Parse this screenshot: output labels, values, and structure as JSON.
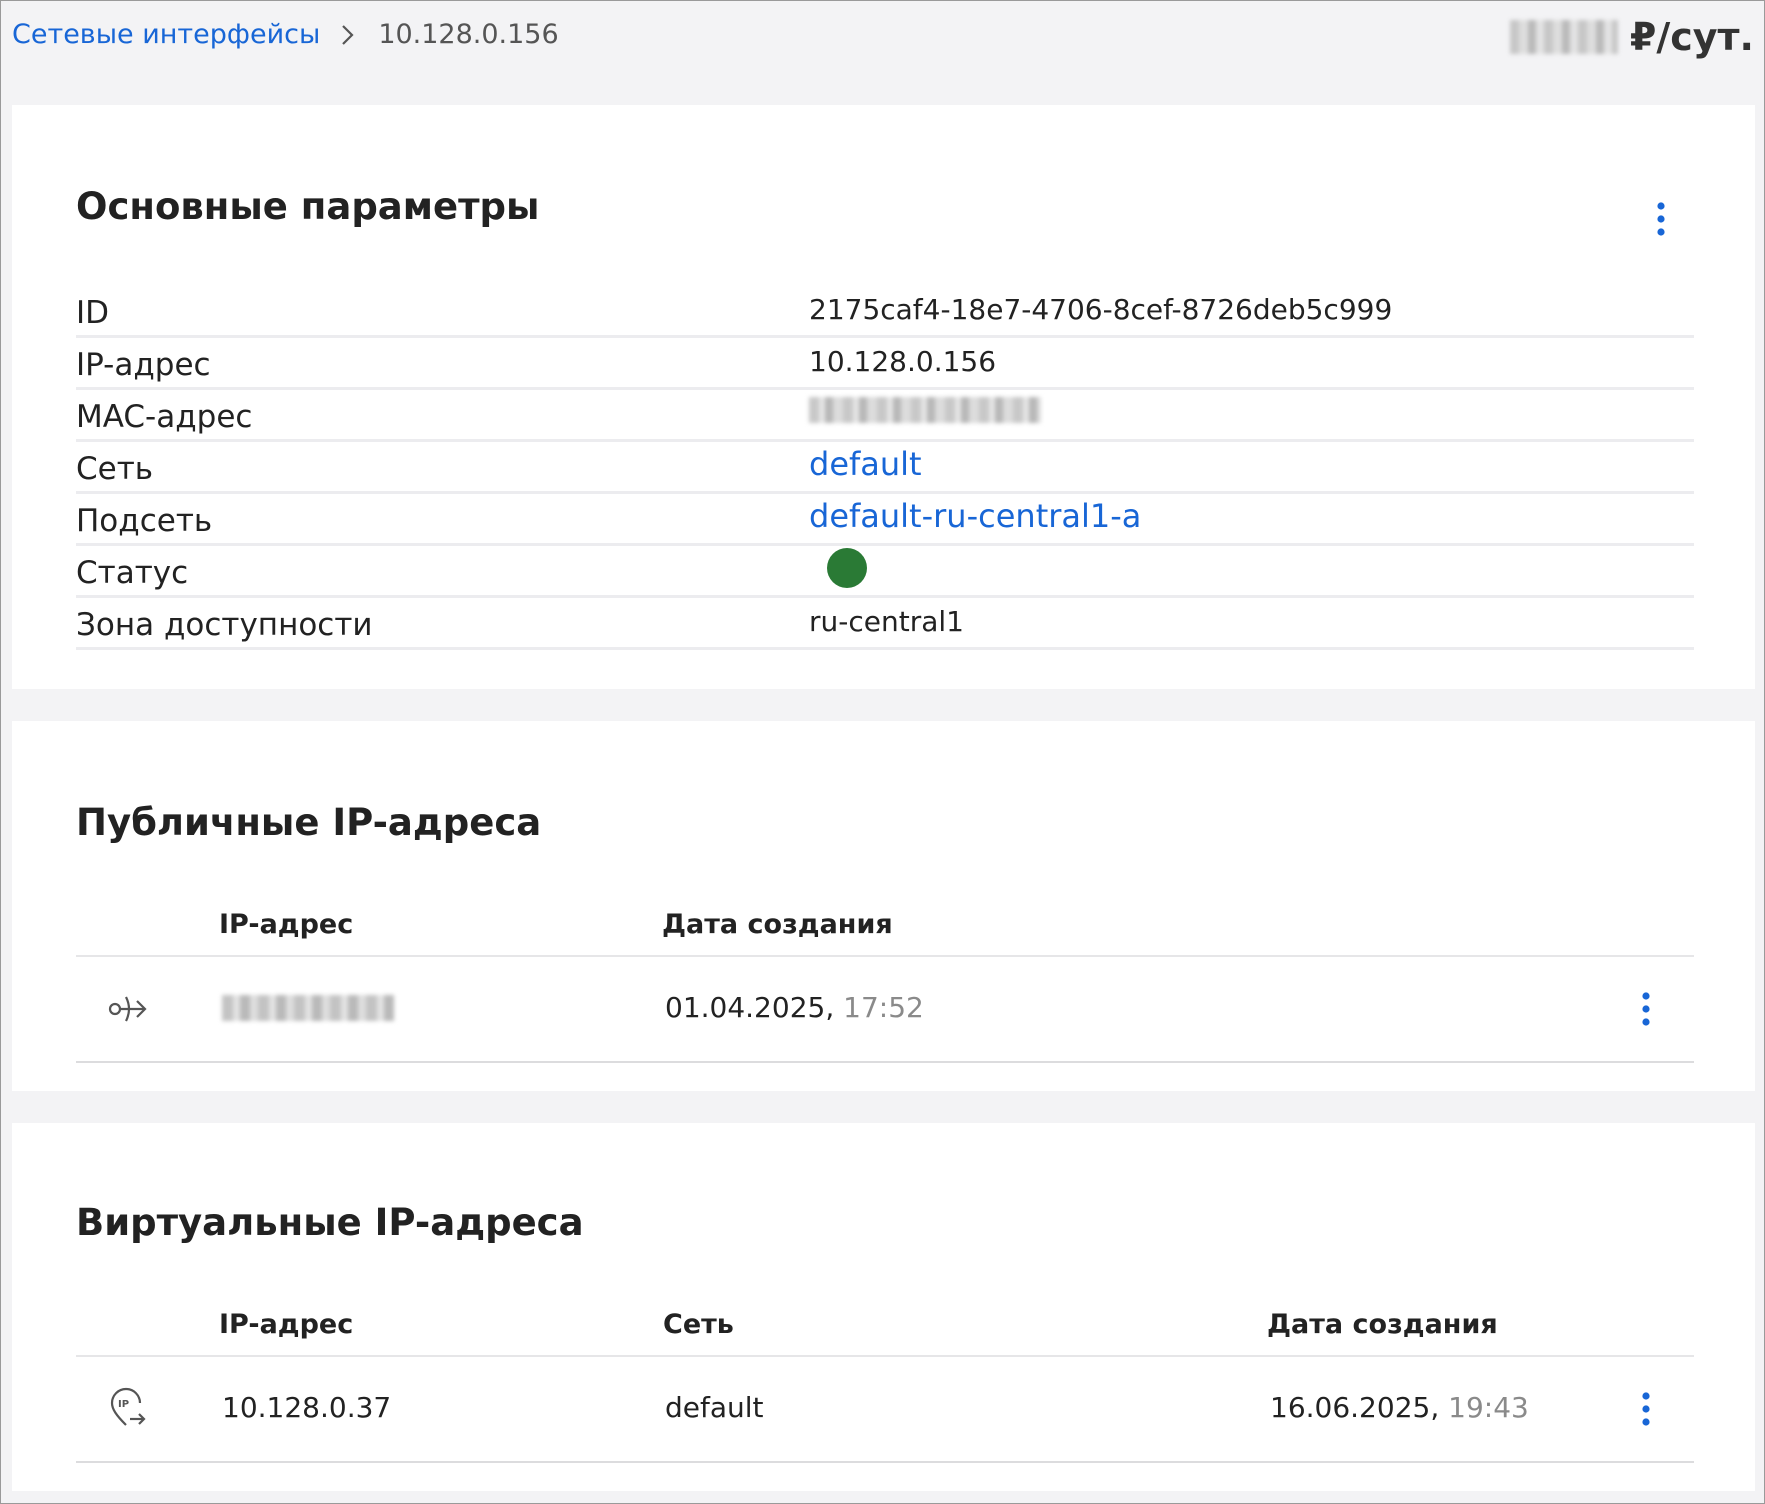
{
  "breadcrumb": {
    "parent": "Сетевые интерфейсы",
    "current": "10.128.0.156"
  },
  "cost": {
    "unit": "₽/сут."
  },
  "basic": {
    "title": "Основные параметры",
    "rows": [
      {
        "label": "ID",
        "value": "2175caf4-18e7-4706-8cef-8726deb5c999"
      },
      {
        "label": "IP-адрес",
        "value": "10.128.0.156"
      },
      {
        "label": "MAC-адрес",
        "value": ""
      },
      {
        "label": "Сеть",
        "value": "default"
      },
      {
        "label": "Подсеть",
        "value": "default-ru-central1-a"
      },
      {
        "label": "Статус",
        "value": ""
      },
      {
        "label": "Зона доступности",
        "value": "ru-central1"
      }
    ],
    "status_color": "#2a7a35"
  },
  "public_ips": {
    "title": "Публичные IP-адреса",
    "columns": [
      "IP-адрес",
      "Дата создания"
    ],
    "rows": [
      {
        "icon": "public-ip-icon",
        "ip": "",
        "date": "01.04.2025,",
        "time": "17:52"
      }
    ]
  },
  "virtual_ips": {
    "title": "Виртуальные IP-адреса",
    "columns": [
      "IP-адрес",
      "Сеть",
      "Дата создания"
    ],
    "rows": [
      {
        "icon": "virtual-ip-icon",
        "ip": "10.128.0.37",
        "network": "default",
        "date": "16.06.2025,",
        "time": "19:43"
      }
    ]
  },
  "colors": {
    "accent": "#1866d6",
    "background": "#f3f3f5",
    "muted_text": "#8a8a8a"
  }
}
